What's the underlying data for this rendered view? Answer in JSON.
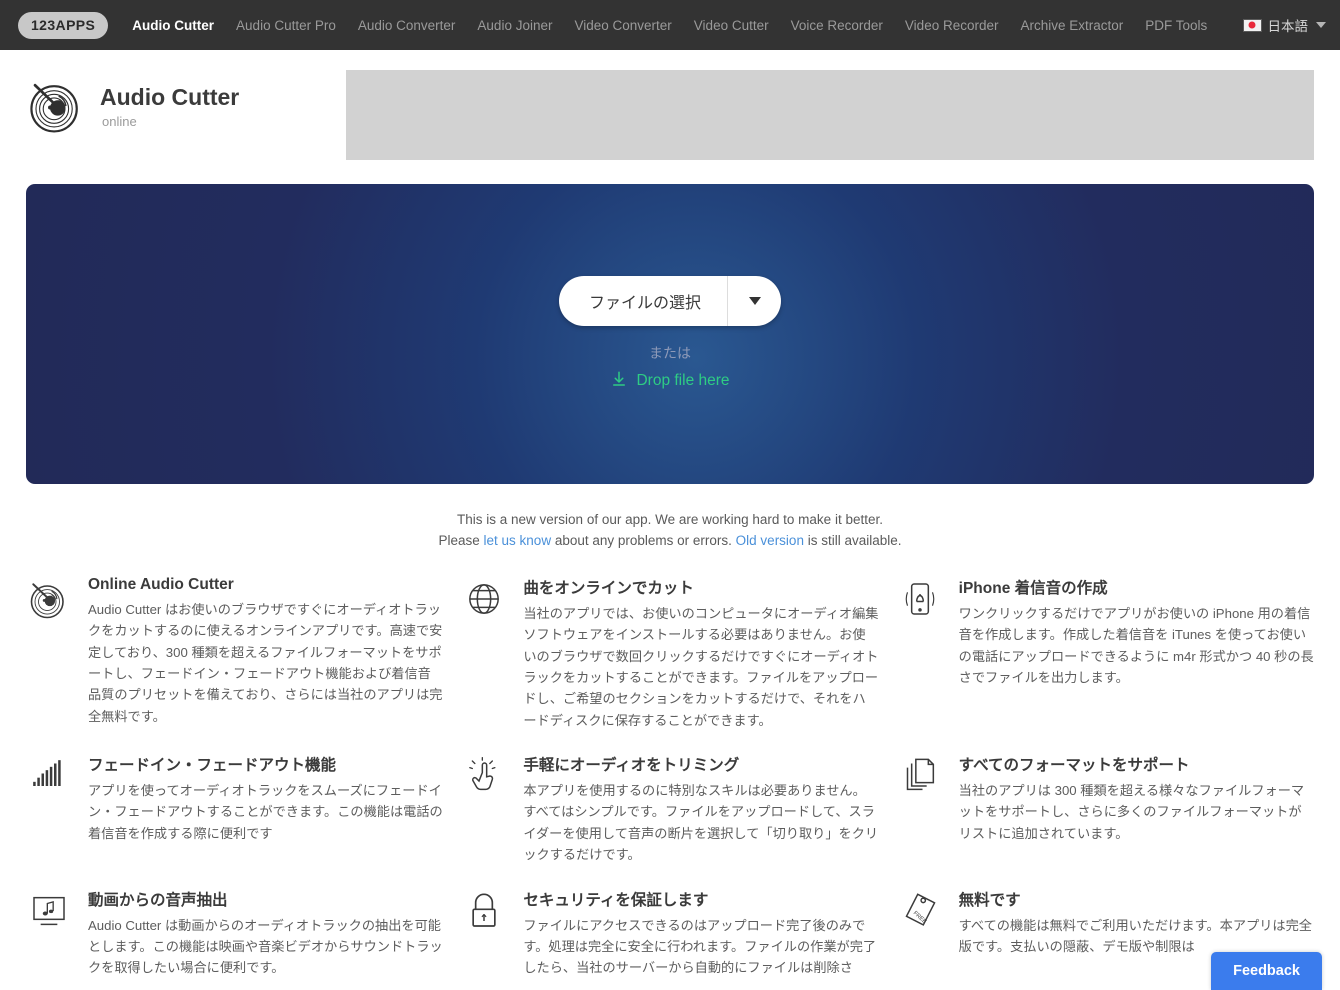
{
  "navbar": {
    "brand": "123APPS",
    "links": [
      {
        "label": "Audio Cutter",
        "active": true
      },
      {
        "label": "Audio Cutter Pro",
        "active": false
      },
      {
        "label": "Audio Converter",
        "active": false
      },
      {
        "label": "Audio Joiner",
        "active": false
      },
      {
        "label": "Video Converter",
        "active": false
      },
      {
        "label": "Video Cutter",
        "active": false
      },
      {
        "label": "Voice Recorder",
        "active": false
      },
      {
        "label": "Video Recorder",
        "active": false
      },
      {
        "label": "Archive Extractor",
        "active": false
      },
      {
        "label": "PDF Tools",
        "active": false
      }
    ],
    "language": {
      "label": "日本語",
      "flag_icon": "japan-flag-icon",
      "caret_icon": "chevron-down-icon"
    }
  },
  "header": {
    "logo_icon": "vinyl-record-icon",
    "title": "Audio Cutter",
    "subtitle": "online",
    "ad_placeholder_color": "#d2d2d2"
  },
  "hero": {
    "choose_file_label": "ファイルの選択",
    "dropdown_icon": "caret-down-icon",
    "or_label": "または",
    "drop_label": "Drop file here",
    "drop_icon": "download-arrow-icon",
    "accent_color": "#2ecc84",
    "background_color": "#222c5e"
  },
  "notice": {
    "line1": "This is a new version of our app. We are working hard to make it better.",
    "line2_pre": "Please ",
    "link1": "let us know",
    "line2_mid": " about any problems or errors. ",
    "link2": "Old version",
    "line2_post": " is still available.",
    "link_color": "#4a90d9"
  },
  "features": [
    {
      "icon": "vinyl-record-icon",
      "title": "Online Audio Cutter",
      "body": "Audio Cutter はお使いのブラウザですぐにオーディオトラックをカットするのに使えるオンラインアプリです。高速で安定しており、300 種類を超えるファイルフォーマットをサポートし、フェードイン・フェードアウト機能および着信音品質のプリセットを備えており、さらには当社のアプリは完全無料です。"
    },
    {
      "icon": "globe-icon",
      "title": "曲をオンラインでカット",
      "body": "当社のアプリでは、お使いのコンピュータにオーディオ編集ソフトウェアをインストールする必要はありません。お使いのブラウザで数回クリックするだけですぐにオーディオトラックをカットすることができます。ファイルをアップロードし、ご希望のセクションをカットするだけで、それをハードディスクに保存することができます。"
    },
    {
      "icon": "phone-ringtone-icon",
      "title": "iPhone 着信音の作成",
      "body": "ワンクリックするだけでアプリがお使いの iPhone 用の着信音を作成します。作成した着信音を iTunes を使ってお使いの電話にアップロードできるように m4r 形式かつ 40 秒の長さでファイルを出力します。"
    },
    {
      "icon": "equalizer-bars-icon",
      "title": "フェードイン・フェードアウト機能",
      "body": "アプリを使ってオーディオトラックをスムーズにフェードイン・フェードアウトすることができます。この機能は電話の着信音を作成する際に便利です"
    },
    {
      "icon": "click-hand-icon",
      "title": "手軽にオーディオをトリミング",
      "body": "本アプリを使用するのに特別なスキルは必要ありません。すべてはシンプルです。ファイルをアップロードして、スライダーを使用して音声の断片を選択して「切り取り」をクリックするだけです。"
    },
    {
      "icon": "copy-files-icon",
      "title": "すべてのフォーマットをサポート",
      "body": "当社のアプリは 300 種類を超える様々なファイルフォーマットをサポートし、さらに多くのファイルフォーマットがリストに追加されています。"
    },
    {
      "icon": "monitor-music-icon",
      "title": "動画からの音声抽出",
      "body": "Audio Cutter は動画からのオーディオトラックの抽出を可能とします。この機能は映画や音楽ビデオからサウンドトラックを取得したい場合に便利です。"
    },
    {
      "icon": "lock-icon",
      "title": "セキュリティを保証します",
      "body": "ファイルにアクセスできるのはアップロード完了後のみです。処理は完全に安全に行われます。ファイルの作業が完了したら、当社のサーバーから自動的にファイルは削除さ"
    },
    {
      "icon": "free-tag-icon",
      "title": "無料です",
      "body": "すべての機能は無料でご利用いただけます。本アプリは完全版です。支払いの隠蔽、デモ版や制限は"
    }
  ],
  "feedback": {
    "label": "Feedback",
    "color": "#3b7ced"
  }
}
